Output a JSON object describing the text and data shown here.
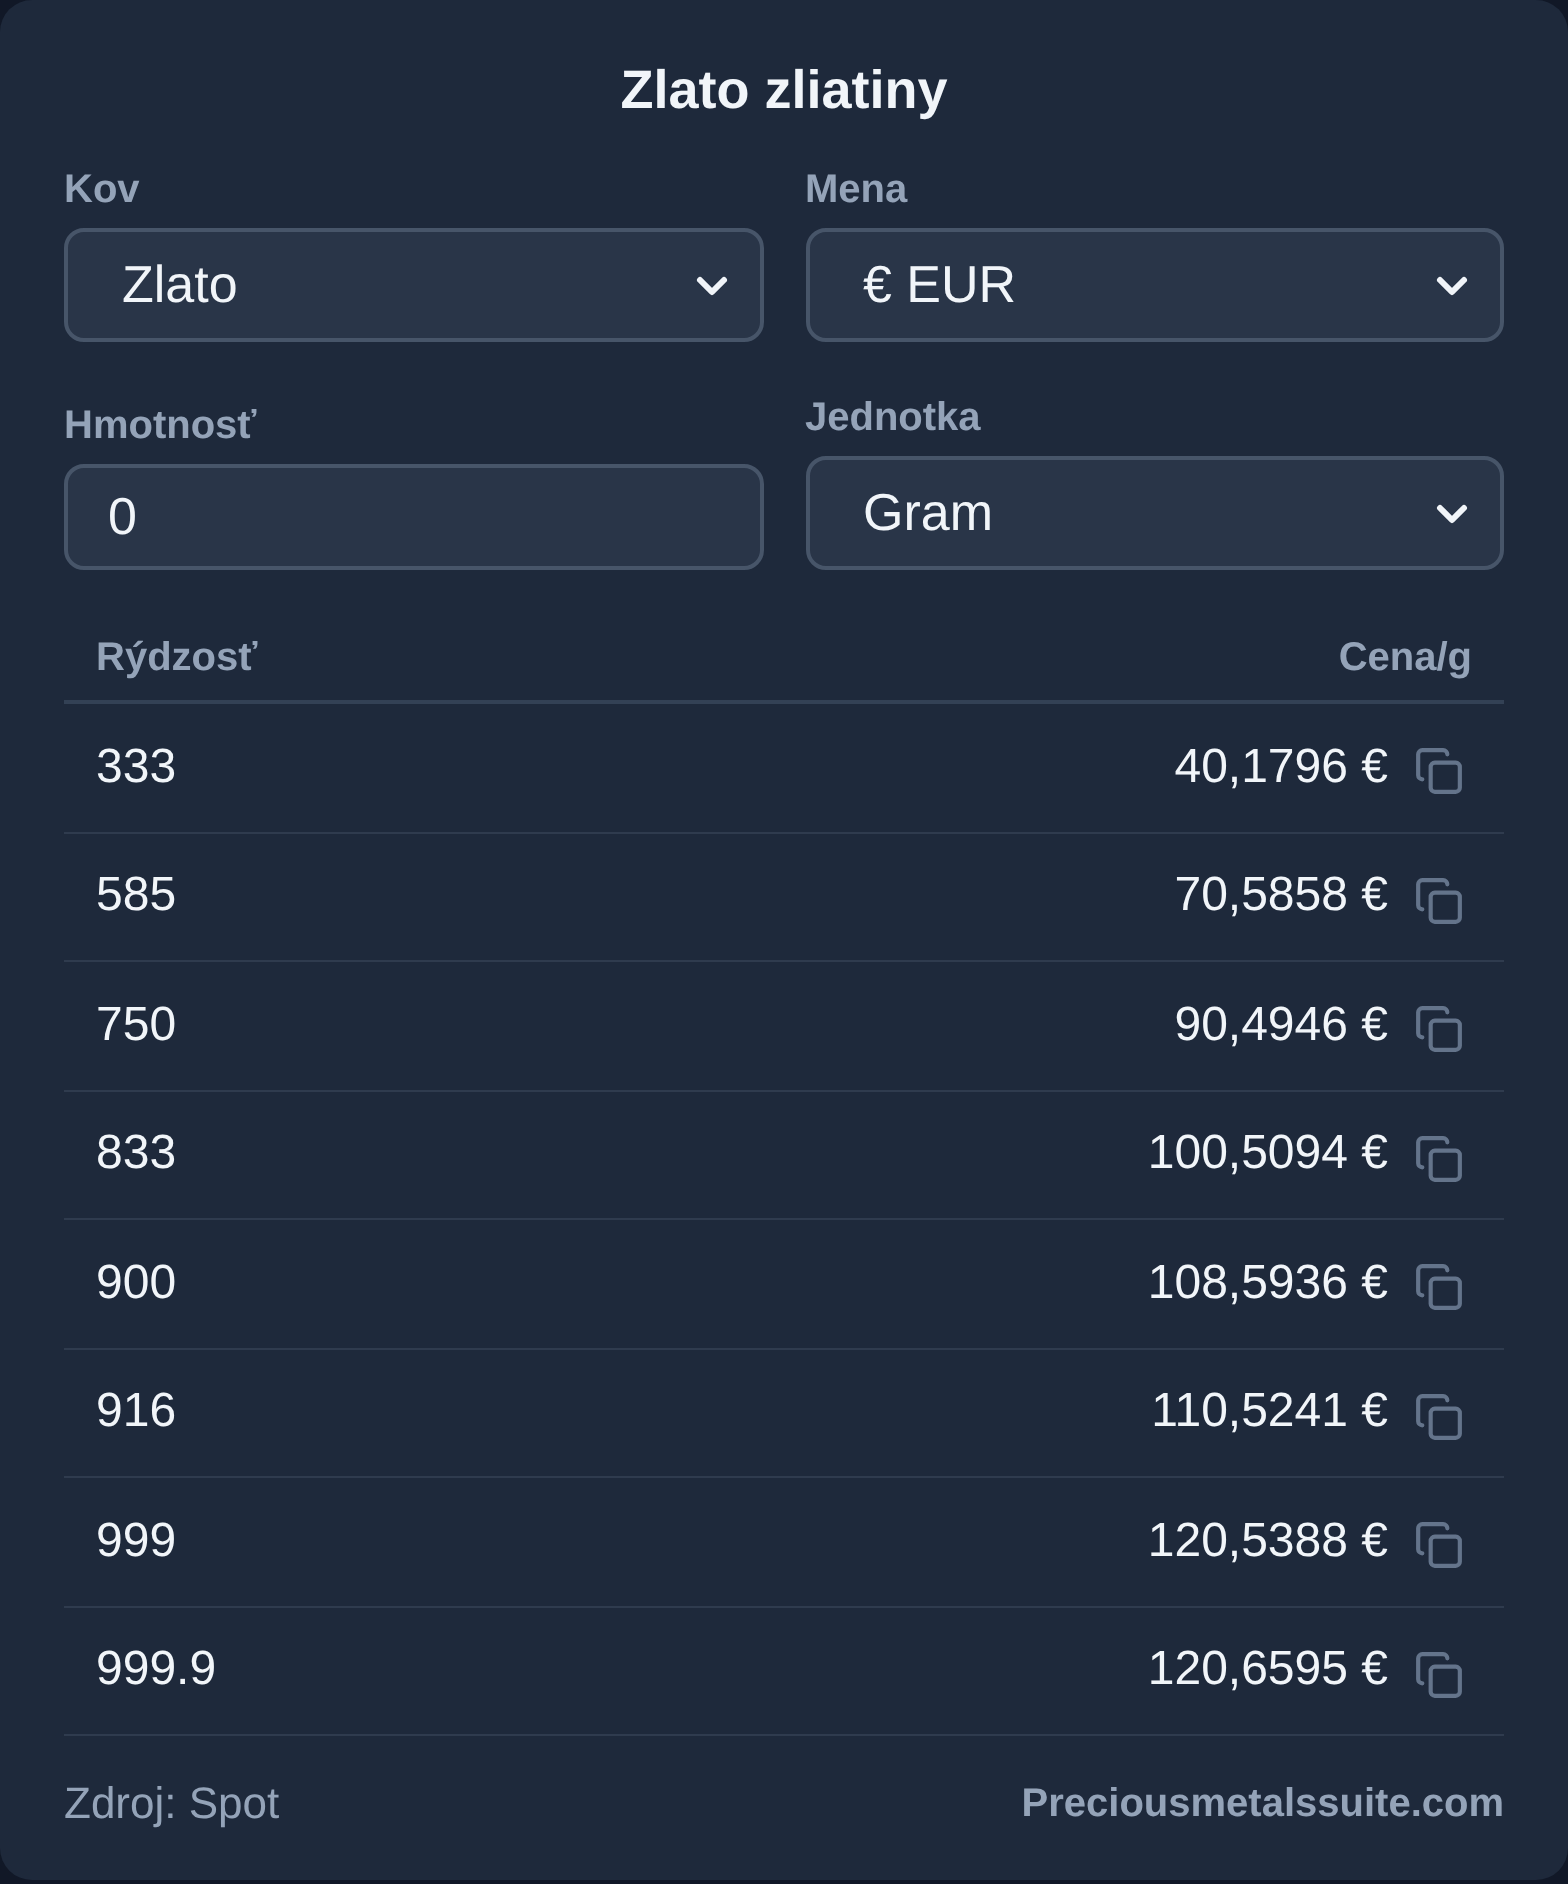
{
  "title": "Zlato zliatiny",
  "fields": [
    {
      "kind": "select",
      "label": "Kov",
      "value": "Zlato"
    },
    {
      "kind": "select",
      "label": "Mena",
      "value": "€ EUR"
    },
    {
      "kind": "input",
      "label": "Hmotnosť",
      "value": "0"
    },
    {
      "kind": "select",
      "label": "Jednotka",
      "value": "Gram"
    }
  ],
  "table": {
    "columns": [
      "Rýdzosť",
      "Cena/g"
    ],
    "rows": [
      {
        "purity": "333",
        "price": "40,1796 €"
      },
      {
        "purity": "585",
        "price": "70,5858 €"
      },
      {
        "purity": "750",
        "price": "90,4946 €"
      },
      {
        "purity": "833",
        "price": "100,5094 €"
      },
      {
        "purity": "900",
        "price": "108,5936 €"
      },
      {
        "purity": "916",
        "price": "110,5241 €"
      },
      {
        "purity": "999",
        "price": "120,5388 €"
      },
      {
        "purity": "999.9",
        "price": "120,6595 €"
      }
    ]
  },
  "footer": {
    "source": "Zdroj: Spot",
    "link": "Preciousmetalssuite.com"
  }
}
